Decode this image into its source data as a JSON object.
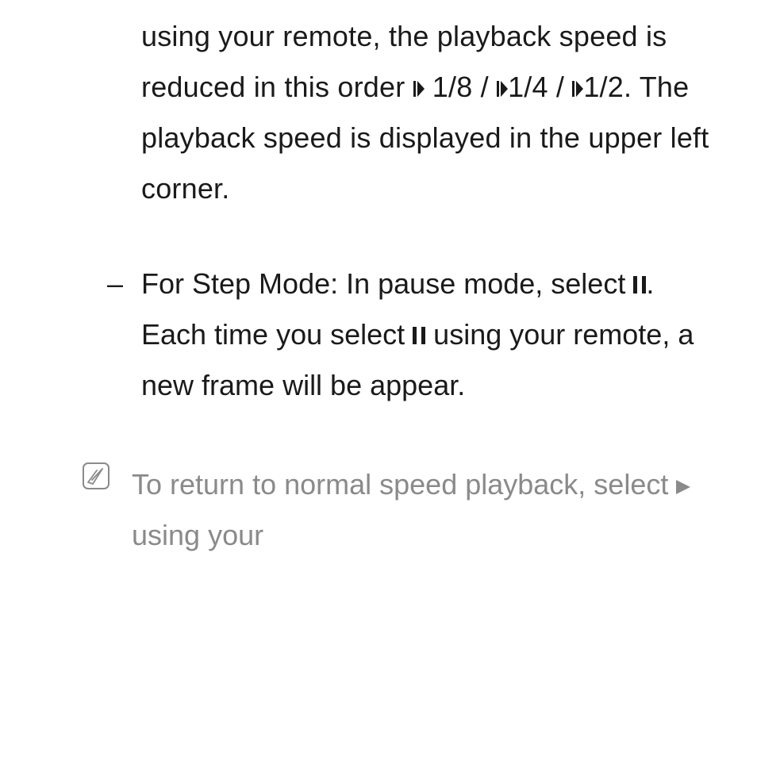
{
  "para1": {
    "t1": "using your remote, the playback speed is reduced in this order ",
    "speed1": "1/8 / ",
    "speed2": "1/4 / ",
    "speed3": "1/2. ",
    "t2": "The playback speed is displayed in the upper left corner."
  },
  "para2": {
    "t1": "For Step Mode: In pause mode, select ",
    "t2": ". Each time you select ",
    "t3": " using your remote, a new frame will be appear."
  },
  "note": {
    "t1": "To return to normal speed playback, select ",
    "t2": " using your"
  }
}
